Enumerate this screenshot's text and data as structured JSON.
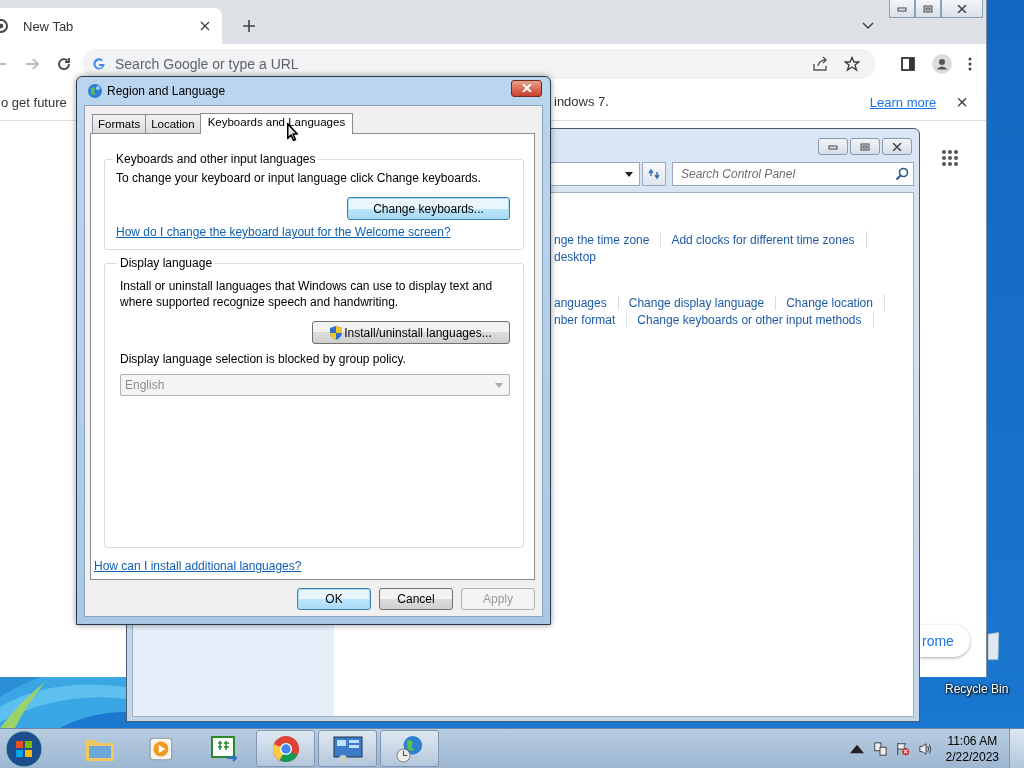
{
  "browser": {
    "tab": {
      "title": "New Tab"
    },
    "omnibox": {
      "placeholder": "Search Google or type a URL"
    },
    "infobar": {
      "text_start": "o get future",
      "text_end": "indows 7.",
      "link": "Learn more",
      "close": "×"
    },
    "partial_button": "rome"
  },
  "control_panel": {
    "search": {
      "placeholder": "Search Control Panel"
    },
    "link_rows": [
      [
        "nge the time zone",
        "Add clocks for different time zones"
      ],
      [
        "desktop"
      ],
      [
        "anguages",
        "Change display language",
        "Change location"
      ],
      [
        "nber format",
        "Change keyboards or other input methods"
      ]
    ]
  },
  "dialog": {
    "title": "Region and Language",
    "tabs": [
      {
        "label": "Formats",
        "selected": false
      },
      {
        "label": "Location",
        "selected": false
      },
      {
        "label": "Keyboards and Languages",
        "selected": true
      }
    ],
    "keyboards_group": {
      "title": "Keyboards and other input languages",
      "text": "To change your keyboard or input language click Change keyboards.",
      "button": {
        "label": "Change keyboards...",
        "focused": true
      },
      "link": "How do I change the keyboard layout for the Welcome screen?"
    },
    "display_group": {
      "title": "Display language",
      "text": "Install or uninstall languages that Windows can use to display text and where supported recognize speech and handwriting.",
      "button": {
        "label": "Install/uninstall languages...",
        "focused": false
      },
      "note": "Display language selection is blocked by group policy.",
      "select": {
        "value": "English",
        "disabled": true
      }
    },
    "link": "How can I install additional languages?",
    "buttons": [
      {
        "label": "OK",
        "focused": true,
        "disabled": false
      },
      {
        "label": "Cancel",
        "focused": false,
        "disabled": false
      },
      {
        "label": "Apply",
        "focused": false,
        "disabled": true
      }
    ]
  },
  "desktop": {
    "icons": [
      {
        "label": "Recycle Bin"
      }
    ]
  },
  "taskbar": {
    "items": [
      {
        "kind": "folder",
        "running": false
      },
      {
        "kind": "media",
        "running": false
      },
      {
        "kind": "csharp",
        "running": false
      },
      {
        "kind": "chrome",
        "running": true
      },
      {
        "kind": "panel",
        "running": true
      },
      {
        "kind": "globe",
        "running": true
      }
    ],
    "clock": {
      "time": "11:06 AM",
      "date": "2/22/2023"
    }
  }
}
